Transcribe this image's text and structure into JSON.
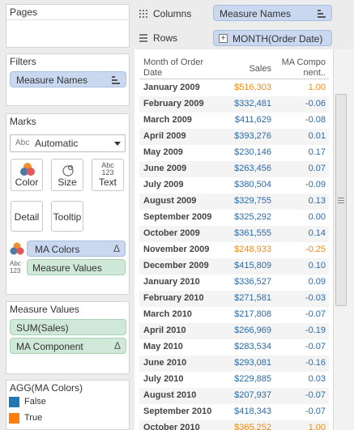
{
  "pages_card": {
    "title": "Pages"
  },
  "filters_card": {
    "title": "Filters",
    "pills": [
      {
        "label": "Measure Names"
      }
    ]
  },
  "marks_card": {
    "title": "Marks",
    "mark_type": "Automatic",
    "mark_type_prefix": "Abc",
    "buttons": {
      "color": "Color",
      "size": "Size",
      "text": "Text",
      "detail": "Detail",
      "tooltip": "Tooltip"
    },
    "text_icon_lines": [
      "Abc",
      "123"
    ],
    "color_pill": {
      "label": "MA Colors",
      "icon": "Δ"
    },
    "text_pill": {
      "label": "Measure Values",
      "icon_lines": [
        "Abc",
        "123"
      ]
    }
  },
  "measure_values_card": {
    "title": "Measure Values",
    "pills": [
      {
        "label": "SUM(Sales)",
        "icon": ""
      },
      {
        "label": "MA Component",
        "icon": "Δ"
      }
    ]
  },
  "legend_card": {
    "title": "AGG(MA Colors)",
    "items": [
      {
        "label": "False",
        "color": "#1f77b4"
      },
      {
        "label": "True",
        "color": "#ff7f0e"
      }
    ]
  },
  "shelves": {
    "columns_label": "Columns",
    "columns_pill": "Measure Names",
    "rows_label": "Rows",
    "rows_pill": "MONTH(Order Date)",
    "rows_pill_icon": "+"
  },
  "table": {
    "headers": {
      "month_line1": "Month of Order",
      "month_line2": "Date",
      "sales": "Sales",
      "ma_line1": "MA Compo",
      "ma_line2": "nent.."
    },
    "colors": {
      "false": "#2c6aa8",
      "true": "#ee8b15"
    },
    "rows": [
      {
        "month": "January 2009",
        "sales": "$516,303",
        "ma": "1.00",
        "highlight": true
      },
      {
        "month": "February 2009",
        "sales": "$332,481",
        "ma": "-0.06",
        "highlight": false
      },
      {
        "month": "March 2009",
        "sales": "$411,629",
        "ma": "-0.08",
        "highlight": false
      },
      {
        "month": "April 2009",
        "sales": "$393,276",
        "ma": "0.01",
        "highlight": false
      },
      {
        "month": "May 2009",
        "sales": "$230,146",
        "ma": "0.17",
        "highlight": false
      },
      {
        "month": "June 2009",
        "sales": "$263,456",
        "ma": "0.07",
        "highlight": false
      },
      {
        "month": "July 2009",
        "sales": "$380,504",
        "ma": "-0.09",
        "highlight": false
      },
      {
        "month": "August 2009",
        "sales": "$329,755",
        "ma": "0.13",
        "highlight": false
      },
      {
        "month": "September 2009",
        "sales": "$325,292",
        "ma": "0.00",
        "highlight": false
      },
      {
        "month": "October 2009",
        "sales": "$361,555",
        "ma": "0.14",
        "highlight": false
      },
      {
        "month": "November 2009",
        "sales": "$248,933",
        "ma": "-0.25",
        "highlight": true
      },
      {
        "month": "December 2009",
        "sales": "$415,809",
        "ma": "0.10",
        "highlight": false
      },
      {
        "month": "January 2010",
        "sales": "$336,527",
        "ma": "0.09",
        "highlight": false
      },
      {
        "month": "February 2010",
        "sales": "$271,581",
        "ma": "-0.03",
        "highlight": false
      },
      {
        "month": "March 2010",
        "sales": "$217,808",
        "ma": "-0.07",
        "highlight": false
      },
      {
        "month": "April 2010",
        "sales": "$266,969",
        "ma": "-0.19",
        "highlight": false
      },
      {
        "month": "May 2010",
        "sales": "$283,534",
        "ma": "-0.07",
        "highlight": false
      },
      {
        "month": "June 2010",
        "sales": "$293,081",
        "ma": "-0.16",
        "highlight": false
      },
      {
        "month": "July 2010",
        "sales": "$229,885",
        "ma": "0.03",
        "highlight": false
      },
      {
        "month": "August 2010",
        "sales": "$207,937",
        "ma": "-0.07",
        "highlight": false
      },
      {
        "month": "September 2010",
        "sales": "$418,343",
        "ma": "-0.07",
        "highlight": false
      },
      {
        "month": "October 2010",
        "sales": "$365,252",
        "ma": "1.00",
        "highlight": true
      }
    ]
  }
}
